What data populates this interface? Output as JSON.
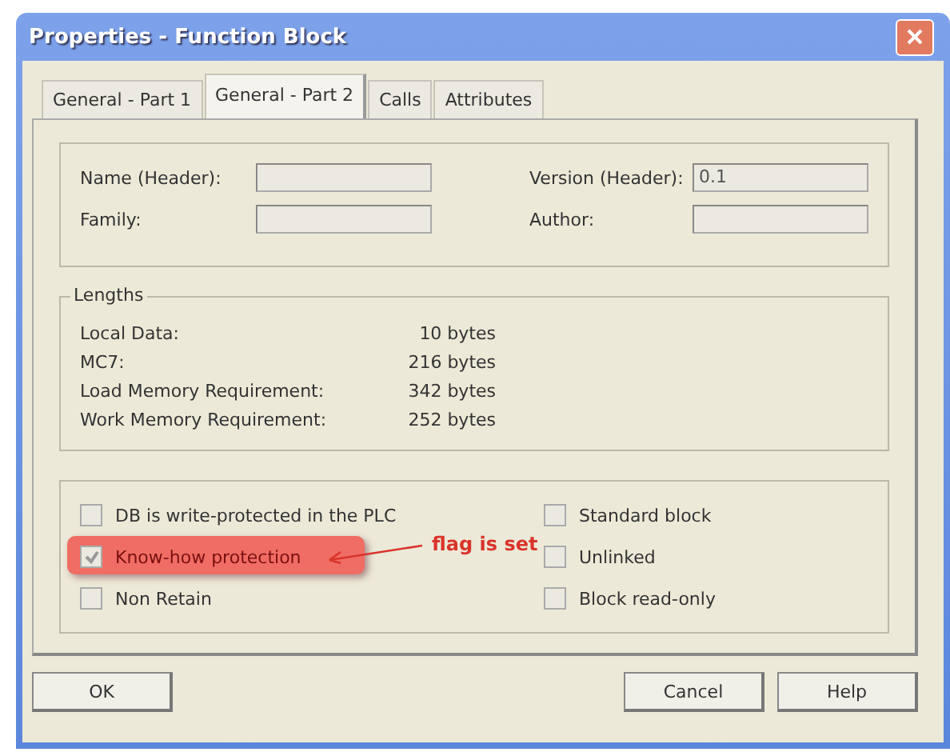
{
  "window": {
    "title": "Properties - Function Block"
  },
  "tabs": [
    {
      "label": "General - Part 1",
      "selected": false
    },
    {
      "label": "General - Part 2",
      "selected": true
    },
    {
      "label": "Calls",
      "selected": false
    },
    {
      "label": "Attributes",
      "selected": false
    }
  ],
  "header_fields": [
    {
      "label": "Name (Header):"
    },
    {
      "label": "Version (Header):",
      "value": "0.1"
    },
    {
      "label": "Family:"
    },
    {
      "label": "Author:"
    }
  ],
  "lengths": {
    "title": "Lengths",
    "rows": [
      {
        "label": "Local Data:",
        "value": "10 bytes"
      },
      {
        "label": "MC7:",
        "value": "216 bytes"
      },
      {
        "label": "Load Memory Requirement:",
        "value": "342 bytes"
      },
      {
        "label": "Work Memory Requirement:",
        "value": "252 bytes"
      }
    ]
  },
  "options_left": [
    {
      "label": "DB is write-protected in the PLC",
      "checked": false,
      "highlighted": false
    },
    {
      "label": "Know-how protection",
      "checked": true,
      "highlighted": true
    },
    {
      "label": "Non Retain",
      "checked": false,
      "highlighted": false
    }
  ],
  "options_right": [
    {
      "label": "Standard block",
      "checked": false
    },
    {
      "label": "Unlinked",
      "checked": false
    },
    {
      "label": "Block read-only",
      "checked": false
    }
  ],
  "annotation": {
    "text": "flag is set"
  },
  "buttons": {
    "left": [
      "OK"
    ],
    "right": [
      "Cancel",
      "Help"
    ]
  }
}
